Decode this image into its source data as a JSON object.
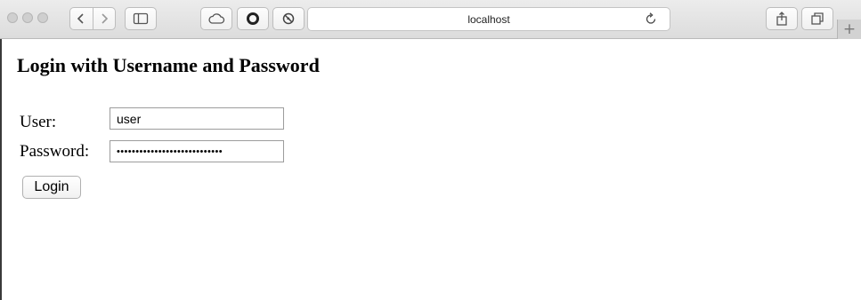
{
  "browser": {
    "address_text": "localhost",
    "new_tab_symbol": "+",
    "icons": [
      "close-dot-icon",
      "minimize-dot-icon",
      "zoom-dot-icon",
      "back-arrow-icon",
      "forward-arrow-icon",
      "sidebar-icon",
      "cloud-icon",
      "opera-icon",
      "ghostery-icon",
      "reload-icon",
      "share-icon",
      "tabs-overview-icon"
    ]
  },
  "page": {
    "heading": "Login with Username and Password",
    "user_label": "User:",
    "user_value": "user",
    "password_label": "Password:",
    "password_value": "••••••••••••••••••••••••••••",
    "login_button": "Login"
  }
}
